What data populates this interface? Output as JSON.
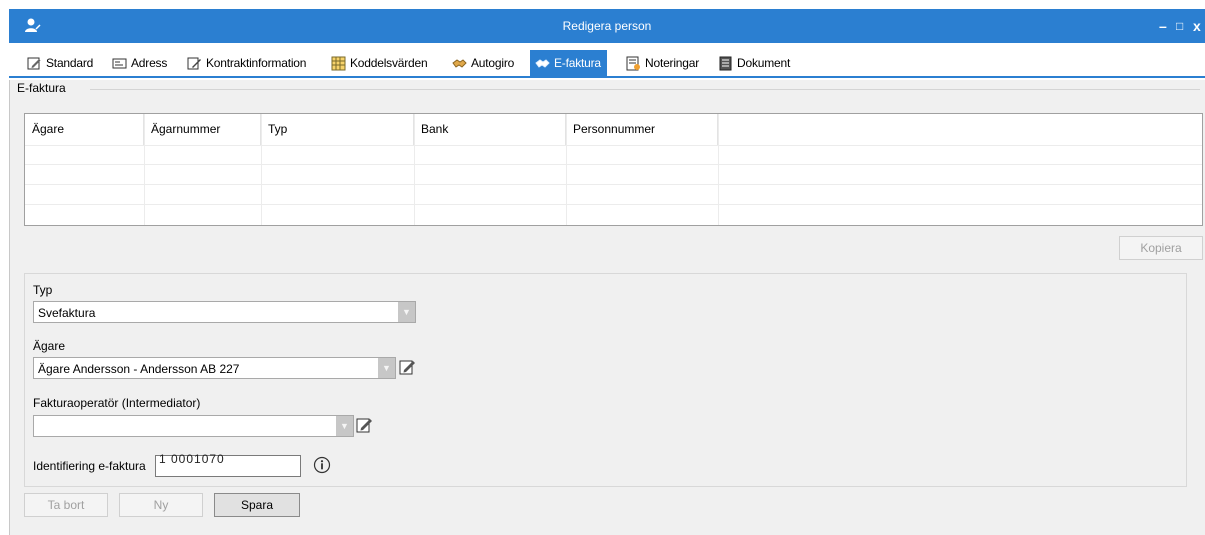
{
  "window": {
    "title": "Redigera person",
    "minimize_label": "–",
    "maximize_label": "□",
    "close_label": "x",
    "accent_color": "#2b7fd1"
  },
  "tabs": [
    {
      "label": "Standard",
      "icon": "edit-icon",
      "active": false
    },
    {
      "label": "Adress",
      "icon": "address-card-icon",
      "active": false
    },
    {
      "label": "Kontraktinformation",
      "icon": "contract-edit-icon",
      "active": false
    },
    {
      "label": "Koddelsvärden",
      "icon": "code-table-icon",
      "active": false
    },
    {
      "label": "Autogiro",
      "icon": "handshake-icon",
      "active": false
    },
    {
      "label": "E-faktura",
      "icon": "handshake-icon",
      "active": true
    },
    {
      "label": "Noteringar",
      "icon": "notes-icon",
      "active": false
    },
    {
      "label": "Dokument",
      "icon": "document-icon",
      "active": false
    }
  ],
  "efaktura": {
    "section_title": "E-faktura",
    "table": {
      "columns": [
        "Ägare",
        "Ägarnummer",
        "Typ",
        "Bank",
        "Personnummer"
      ],
      "rows": []
    },
    "copy_button": "Kopiera",
    "form": {
      "typ_label": "Typ",
      "typ_value": "Svefaktura",
      "agare_label": "Ägare",
      "agare_value": "Ägare Andersson - Andersson AB  227",
      "operator_label": "Fakturaoperatör (Intermediator)",
      "operator_value": "",
      "identifiering_label": "Identifiering e-faktura",
      "identifiering_value": "1      0001070"
    },
    "buttons": {
      "delete": "Ta bort",
      "new": "Ny",
      "save": "Spara"
    }
  }
}
